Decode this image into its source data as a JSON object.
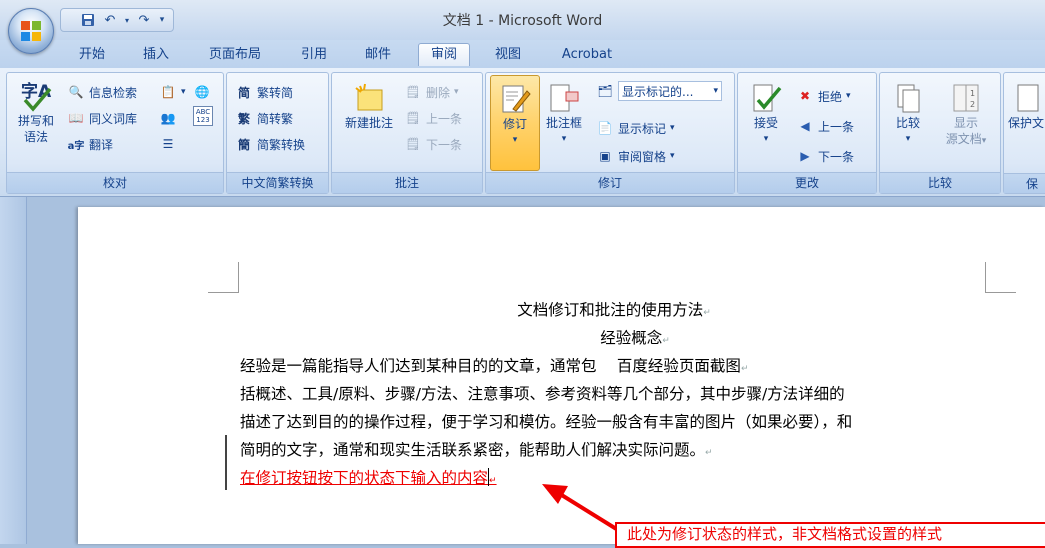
{
  "window": {
    "title": "文档 1 - Microsoft Word"
  },
  "qat": {
    "save": "save-icon",
    "undo": "undo-icon",
    "redo": "redo-icon"
  },
  "tabs": [
    "开始",
    "插入",
    "页面布局",
    "引用",
    "邮件",
    "审阅",
    "视图",
    "Acrobat"
  ],
  "active_tab": "审阅",
  "ribbon": {
    "proofing": {
      "label": "校对",
      "spelling": [
        "拼写和",
        "语法"
      ],
      "research": "信息检索",
      "thesaurus": "同义词库",
      "translate": "翻译"
    },
    "chinese": {
      "label": "中文简繁转换",
      "to_simplified": "繁转简",
      "to_traditional": "简转繁",
      "convert": "简繁转换"
    },
    "comments": {
      "label": "批注",
      "new_comment": "新建批注",
      "delete": "删除",
      "previous": "上一条",
      "next": "下一条"
    },
    "tracking": {
      "label": "修订",
      "track_changes": "修订",
      "balloons": "批注框",
      "display_select": "显示标记的...",
      "show_markup": "显示标记",
      "reviewing_pane": "审阅窗格"
    },
    "changes": {
      "label": "更改",
      "accept": "接受",
      "reject": "拒绝",
      "previous": "上一条",
      "next": "下一条"
    },
    "compare": {
      "label": "比较",
      "compare": "比较",
      "show_source": [
        "显示",
        "源文档"
      ]
    },
    "protect": {
      "label": "保",
      "button": "保护文"
    }
  },
  "document": {
    "title": "文档修订和批注的使用方法",
    "subtitle": "经验概念",
    "lines": [
      "经验是一篇能指导人们达到某种目的的文章，通常包　 百度经验页面截图",
      "括概述、工具/原料、步骤/方法、注意事项、参考资料等几个部分，其中步骤/方法详细的",
      "描述了达到目的的操作过程，便于学习和模仿。经验一般含有丰富的图片（如果必要），和",
      "简明的文字，通常和现实生活联系紧密，能帮助人们解决实际问题。"
    ],
    "revision_text": "在修订按钮按下的状态下输入的内容",
    "paragraph_mark": "↵"
  },
  "annotation": {
    "text": "此处为修订状态的样式，非文档格式设置的样式"
  },
  "colors": {
    "revision": "#e00000",
    "ribbon_text": "#15428b",
    "arrow": "#e00000"
  }
}
